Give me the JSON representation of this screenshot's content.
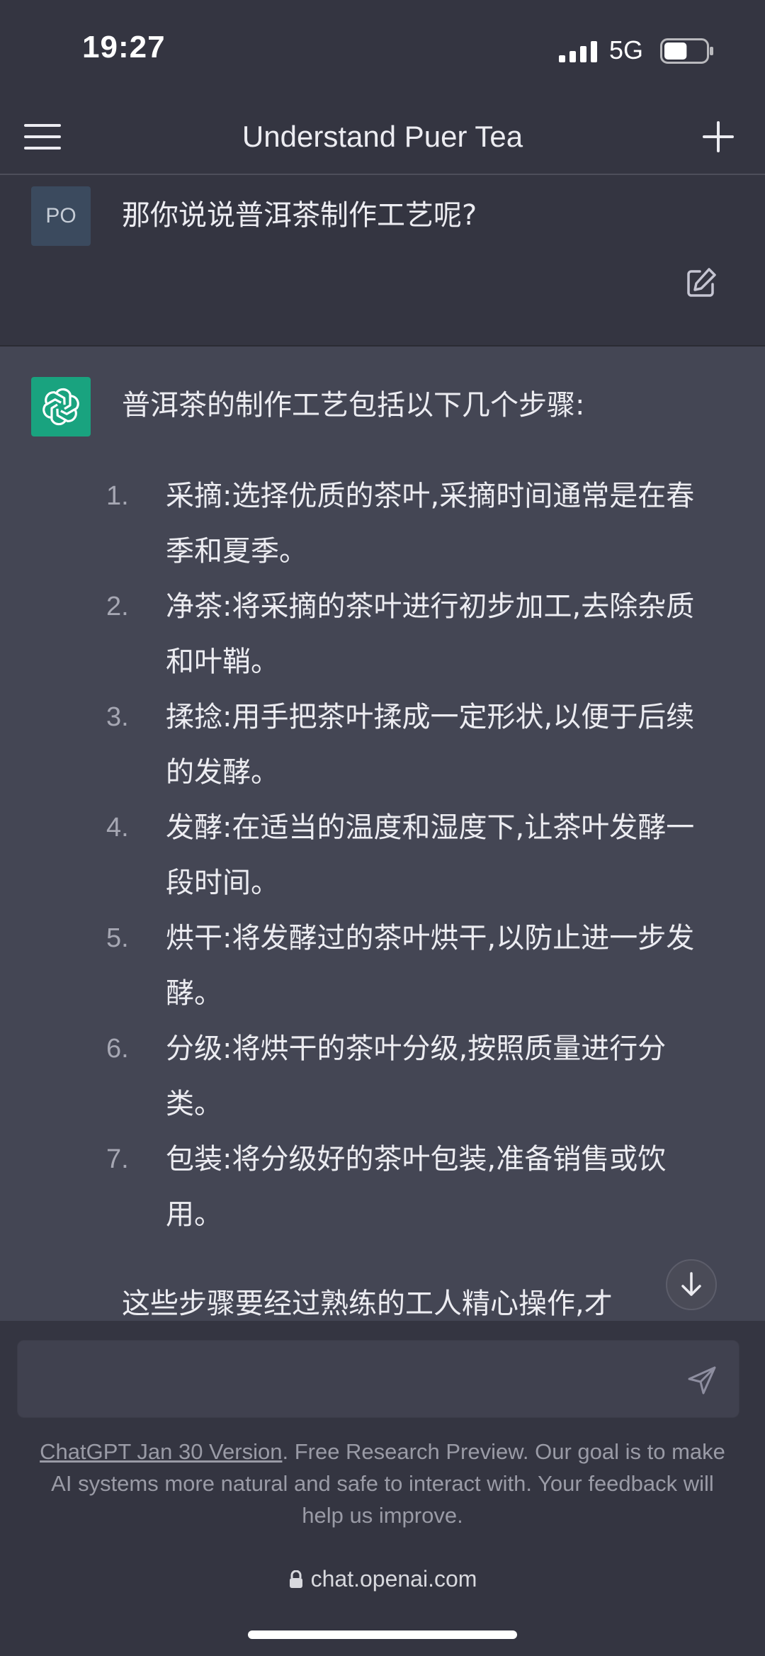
{
  "status_bar": {
    "time": "19:27",
    "network": "5G",
    "battery_level": 0.55
  },
  "nav": {
    "title": "Understand Puer Tea",
    "menu_icon": "hamburger-menu-icon",
    "new_chat_icon": "plus-icon"
  },
  "user_message": {
    "avatar_initials": "PO",
    "text": "那你说说普洱茶制作工艺呢?",
    "edit_icon": "edit-icon"
  },
  "assistant_message": {
    "avatar_icon": "openai-logo-icon",
    "intro": "普洱茶的制作工艺包括以下几个步骤:",
    "steps": [
      {
        "num": "1.",
        "text": "采摘:选择优质的茶叶,采摘时间通常是在春季和夏季。"
      },
      {
        "num": "2.",
        "text": "净茶:将采摘的茶叶进行初步加工,去除杂质和叶鞘。"
      },
      {
        "num": "3.",
        "text": "揉捻:用手把茶叶揉成一定形状,以便于后续的发酵。"
      },
      {
        "num": "4.",
        "text": "发酵:在适当的温度和湿度下,让茶叶发酵一段时间。"
      },
      {
        "num": "5.",
        "text": "烘干:将发酵过的茶叶烘干,以防止进一步发酵。"
      },
      {
        "num": "6.",
        "text": "分级:将烘干的茶叶分级,按照质量进行分类。"
      },
      {
        "num": "7.",
        "text": "包装:将分级好的茶叶包装,准备销售或饮用。"
      }
    ],
    "closing": "这些步骤要经过熟练的工人精心操作,才"
  },
  "input": {
    "value": "",
    "placeholder": "",
    "send_icon": "send-icon"
  },
  "footer": {
    "link_text": "ChatGPT Jan 30 Version",
    "disclaimer_rest": ". Free Research Preview. Our goal is to make AI systems more natural and safe to interact with. Your feedback will help us improve."
  },
  "browser": {
    "url": "chat.openai.com",
    "lock_icon": "lock-icon"
  }
}
